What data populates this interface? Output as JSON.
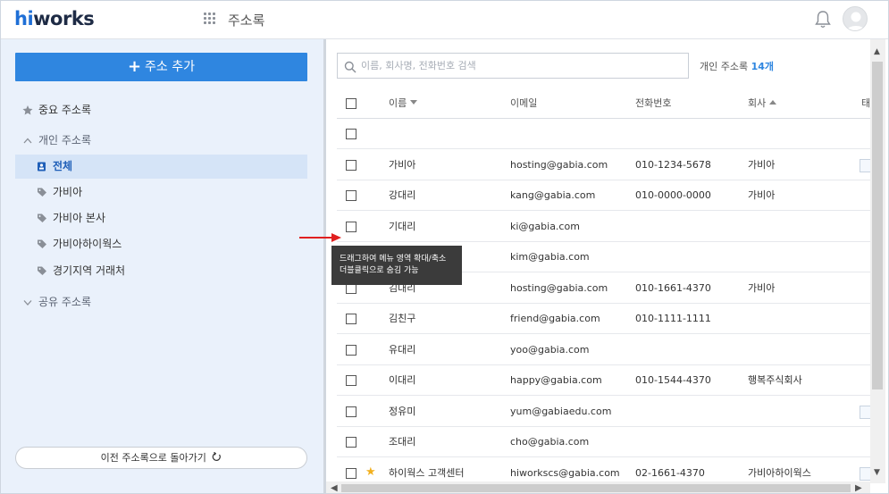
{
  "app": {
    "logo_h": "hi",
    "logo_rest": "works",
    "title": "주소록"
  },
  "sidebar": {
    "add_button": "주소 추가",
    "important": "중요 주소록",
    "personal_group": "개인 주소록",
    "items": [
      "전체",
      "가비아",
      "가비아 본사",
      "가비아하이웍스",
      "경기지역 거래처"
    ],
    "shared_group": "공유 주소록",
    "back_button": "이전 주소록으로 돌아가기"
  },
  "search": {
    "placeholder": "이름, 회사명, 전화번호 검색",
    "value": ""
  },
  "count": {
    "label": "개인 주소록",
    "value": "14개"
  },
  "table": {
    "headers": {
      "name": "이름",
      "email": "이메일",
      "phone": "전화번호",
      "company": "회사",
      "tag": "태"
    },
    "rows": [
      {
        "name": "",
        "email": "",
        "phone": "",
        "company": "",
        "starred": false,
        "mini": false
      },
      {
        "name": "가비아",
        "email": "hosting@gabia.com",
        "phone": "010-1234-5678",
        "company": "가비아",
        "starred": false,
        "mini": true
      },
      {
        "name": "강대리",
        "email": "kang@gabia.com",
        "phone": "010-0000-0000",
        "company": "가비아",
        "starred": false,
        "mini": false
      },
      {
        "name": "기대리",
        "email": "ki@gabia.com",
        "phone": "",
        "company": "",
        "starred": false,
        "mini": false
      },
      {
        "name": "",
        "email": "kim@gabia.com",
        "phone": "",
        "company": "",
        "starred": false,
        "mini": false
      },
      {
        "name": "김대리",
        "email": "hosting@gabia.com",
        "phone": "010-1661-4370",
        "company": "가비아",
        "starred": false,
        "mini": false
      },
      {
        "name": "김친구",
        "email": "friend@gabia.com",
        "phone": "010-1111-1111",
        "company": "",
        "starred": false,
        "mini": false
      },
      {
        "name": "유대리",
        "email": "yoo@gabia.com",
        "phone": "",
        "company": "",
        "starred": false,
        "mini": false
      },
      {
        "name": "이대리",
        "email": "happy@gabia.com",
        "phone": "010-1544-4370",
        "company": "행복주식회사",
        "starred": false,
        "mini": false
      },
      {
        "name": "정유미",
        "email": "yum@gabiaedu.com",
        "phone": "",
        "company": "",
        "starred": false,
        "mini": true
      },
      {
        "name": "조대리",
        "email": "cho@gabia.com",
        "phone": "",
        "company": "",
        "starred": false,
        "mini": false
      },
      {
        "name": "하이웍스 고객센터",
        "email": "hiworkscs@gabia.com",
        "phone": "02-1661-4370",
        "company": "가비아하이웍스",
        "starred": true,
        "mini": true
      }
    ]
  },
  "tooltip": {
    "line1": "드래그하여 메뉴 영역 확대/축소",
    "line2": "더블클릭으로 숨김 가능"
  },
  "colors": {
    "accent": "#2f86e0",
    "sidebar_bg": "#eaf1fb",
    "active_bg": "#d5e4f7",
    "tooltip_bg": "#3b3b3b",
    "arrow": "#e02020",
    "star": "#f2b01e"
  },
  "icons": [
    "apps-grid-icon",
    "bell-icon",
    "avatar-icon",
    "plus-icon",
    "star-icon",
    "chevron-up-icon",
    "address-card-icon",
    "tag-icon",
    "chevron-down-icon",
    "refresh-icon",
    "search-icon",
    "red-arrow-icon"
  ]
}
